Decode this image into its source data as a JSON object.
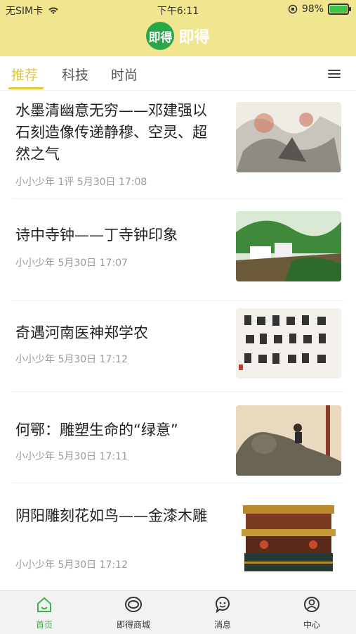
{
  "status": {
    "carrier": "无SIM卡",
    "time": "下午6:11",
    "battery": "98%"
  },
  "header": {
    "logo_text": "即得",
    "app_name": "即得"
  },
  "tabs": [
    {
      "label": "推荐",
      "active": true
    },
    {
      "label": "科技",
      "active": false
    },
    {
      "label": "时尚",
      "active": false
    }
  ],
  "articles": [
    {
      "title": "水墨清幽意无穷——邓建强以石刻造像传递静穆、空灵、超然之气",
      "meta": "小小少年 1评 5月30日 17:08",
      "thumb": "ink-painting-thumbnail"
    },
    {
      "title": "诗中寺钟——丁寺钟印象",
      "meta": "小小少年  5月30日 17:07",
      "thumb": "watercolor-village-thumbnail"
    },
    {
      "title": "奇遇河南医神郑学农",
      "meta": "小小少年  5月30日 17:12",
      "thumb": "calligraphy-thumbnail"
    },
    {
      "title": "何鄂：雕塑生命的“绿意”",
      "meta": "小小少年  5月30日 17:11",
      "thumb": "sculpture-thumbnail"
    },
    {
      "title": "阴阳雕刻花如鸟——金漆木雕",
      "meta": "小小少年  5月30日 17:12",
      "thumb": "gilded-woodcarving-thumbnail"
    }
  ],
  "bottom_nav": [
    {
      "label": "首页",
      "icon": "home-icon",
      "active": true
    },
    {
      "label": "即得商城",
      "icon": "shop-icon",
      "active": false
    },
    {
      "label": "消息",
      "icon": "message-icon",
      "active": false
    },
    {
      "label": "中心",
      "icon": "profile-icon",
      "active": false
    }
  ],
  "colors": {
    "header_bg": "#f1e68f",
    "accent": "#e1c935",
    "brand_green": "#2aa64a",
    "nav_active": "#39b54a"
  }
}
